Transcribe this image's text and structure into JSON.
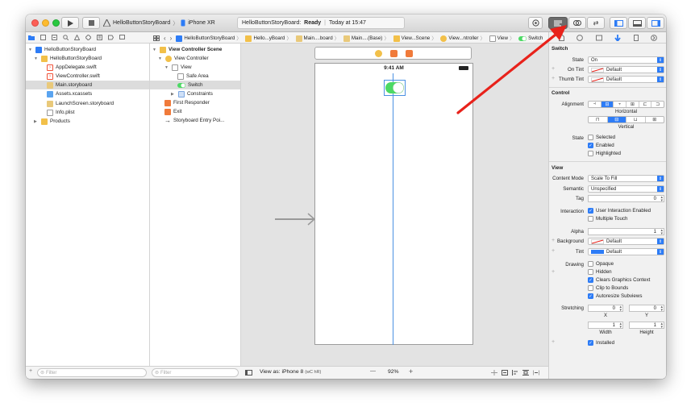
{
  "window": {
    "scheme": "HelloButtonStoryBoard",
    "device": "iPhone XR",
    "status_project": "HelloButtonStoryBoard:",
    "status_state": "Ready",
    "status_time": "Today at 15:47"
  },
  "jumpbar": {
    "crumbs": [
      "HelloButtonStoryBoard",
      "Hello...yBoard",
      "Main....board",
      "Main....(Base)",
      "View...Scene",
      "View...ntroller",
      "View",
      "Switch"
    ]
  },
  "navigator": {
    "items": [
      {
        "label": "HelloButtonStoryBoard",
        "icon": "project-icon"
      },
      {
        "label": "HelloButtonStoryBoard",
        "icon": "folder-icon"
      },
      {
        "label": "AppDelegate.swift",
        "icon": "swift-file-icon"
      },
      {
        "label": "ViewController.swift",
        "icon": "swift-file-icon"
      },
      {
        "label": "Main.storyboard",
        "icon": "storyboard-icon"
      },
      {
        "label": "Assets.xcassets",
        "icon": "assets-icon"
      },
      {
        "label": "LaunchScreen.storyboard",
        "icon": "storyboard-icon"
      },
      {
        "label": "Info.plist",
        "icon": "plist-icon"
      },
      {
        "label": "Products",
        "icon": "folder-icon"
      }
    ],
    "filter_placeholder": "Filter"
  },
  "outline": {
    "items": [
      {
        "label": "View Controller Scene"
      },
      {
        "label": "View Controller"
      },
      {
        "label": "View"
      },
      {
        "label": "Safe Area"
      },
      {
        "label": "Switch"
      },
      {
        "label": "Constraints"
      },
      {
        "label": "First Responder"
      },
      {
        "label": "Exit"
      },
      {
        "label": "Storyboard Entry Poi..."
      }
    ],
    "filter_placeholder": "Filter"
  },
  "canvas": {
    "time": "9:41 AM",
    "view_as": "View as: iPhone 8",
    "view_as_suffix": "(wC hR)",
    "zoom": "92%",
    "minus": "—",
    "plus": "+"
  },
  "inspector": {
    "switch": {
      "title": "Switch",
      "state_label": "State",
      "state_value": "On",
      "on_tint_label": "On Tint",
      "on_tint_value": "Default",
      "thumb_tint_label": "Thumb Tint",
      "thumb_tint_value": "Default"
    },
    "control": {
      "title": "Control",
      "alignment_label": "Alignment",
      "horizontal_label": "Horizontal",
      "vertical_label": "Vertical",
      "state_label": "State",
      "selected": "Selected",
      "enabled": "Enabled",
      "highlighted": "Highlighted"
    },
    "view": {
      "title": "View",
      "content_mode_label": "Content Mode",
      "content_mode_value": "Scale To Fill",
      "semantic_label": "Semantic",
      "semantic_value": "Unspecified",
      "tag_label": "Tag",
      "tag_value": "0",
      "interaction_label": "Interaction",
      "user_interaction": "User Interaction Enabled",
      "multiple_touch": "Multiple Touch",
      "alpha_label": "Alpha",
      "alpha_value": "1",
      "background_label": "Background",
      "background_value": "Default",
      "tint_label": "Tint",
      "tint_value": "Default",
      "drawing_label": "Drawing",
      "opaque": "Opaque",
      "hidden": "Hidden",
      "clears_graphics": "Clears Graphics Context",
      "clip_to_bounds": "Clip to Bounds",
      "autoresize": "Autoresize Subviews",
      "stretching_label": "Stretching",
      "stretch_x": "0",
      "stretch_y": "0",
      "x_label": "X",
      "y_label": "Y",
      "width_value": "1",
      "height_value": "1",
      "width_label": "Width",
      "height_label": "Height",
      "installed": "Installed"
    }
  },
  "colors": {
    "accent": "#2d7cf6",
    "switch_on": "#4cd964",
    "arrow": "#e8221b",
    "folder": "#f2c049"
  }
}
